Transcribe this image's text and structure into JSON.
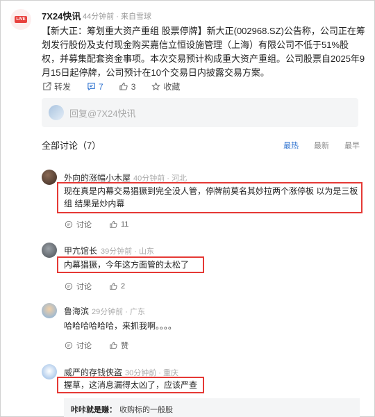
{
  "post": {
    "live_badge": "LIVE",
    "author": "7X24快讯",
    "meta": "44分钟前 · 来自雪球",
    "body": "【新大正：筹划重大资产重组 股票停牌】新大正(002968.SZ)公告称，公司正在筹划发行股份及支付现金购买嘉信立恒设施管理（上海）有限公司不低于51%股权，并募集配套资金事项。本次交易预计构成重大资产重组。公司股票自2025年9月15日起停牌，公司预计在10个交易日内披露交易方案。",
    "actions": {
      "repost": "转发",
      "comments": "7",
      "likes": "3",
      "favorite": "收藏"
    },
    "reply_placeholder": "回复@7X24快讯"
  },
  "discussion": {
    "title": "全部讨论（7）",
    "sort": [
      "最热",
      "最新",
      "最早"
    ],
    "active_sort": "最热"
  },
  "comments": [
    {
      "name": "外向的涨幅小木屋",
      "meta": "40分钟前 · 河北",
      "text": "现在真是内幕交易猖獗到完全没人管，停牌前莫名其妙拉两个涨停板 以为是三板组 结果是炒内幕",
      "discuss": "讨论",
      "likes": "11"
    },
    {
      "name": "甲亢馆长",
      "meta": "39分钟前 · 山东",
      "text": "内幕猖獗，今年这方面管的太松了",
      "discuss": "讨论",
      "likes": "2"
    },
    {
      "name": "鲁海滨",
      "meta": "29分钟前 · 广东",
      "text": "哈哈哈哈哈哈，来抓我啊。。。。",
      "discuss": "讨论",
      "likes": "赞"
    },
    {
      "name": "威严的存钱侠盗",
      "meta": "30分钟前 · 重庆",
      "text": "握草，这消息漏得太凶了，应该严查"
    }
  ],
  "sub_reply": {
    "name": "咔咔就是赚：",
    "text": "收购标的一般股"
  },
  "colors": {
    "accent": "#2f73d0",
    "highlight": "#e53935",
    "live": "#e8413e"
  }
}
